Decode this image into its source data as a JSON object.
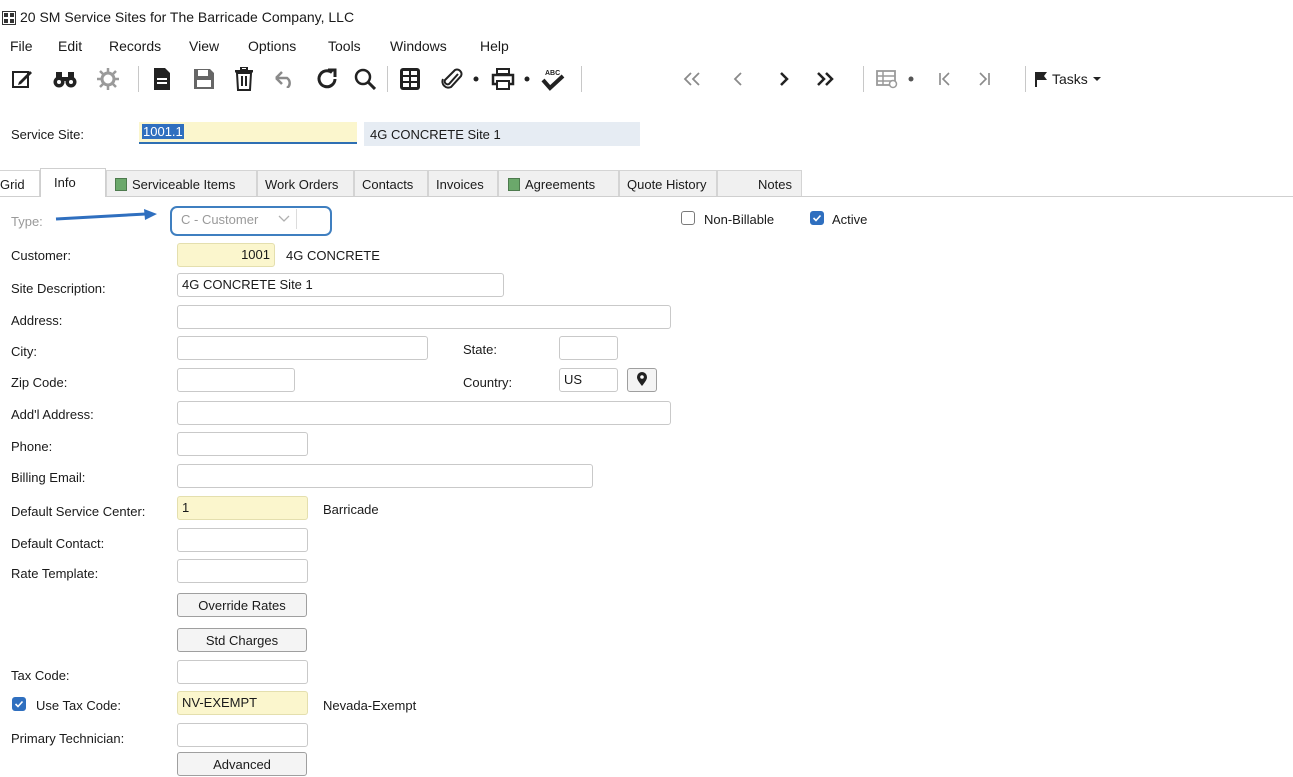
{
  "window": {
    "title": "20 SM Service Sites for The Barricade Company, LLC",
    "icon": "app-window-icon"
  },
  "menu": [
    "File",
    "Edit",
    "Records",
    "View",
    "Options",
    "Tools",
    "Windows",
    "Help"
  ],
  "toolbar": {
    "icons": [
      "edit-icon",
      "binoculars-icon",
      "settings-icon",
      "new-document-icon",
      "save-icon",
      "delete-icon",
      "undo-icon",
      "refresh-icon",
      "search-icon",
      "grid-icon",
      "attachment-icon",
      "print-icon",
      "spellcheck-icon",
      "first-record-icon",
      "previous-record-icon",
      "next-record-icon",
      "last-record-icon",
      "table-view-icon",
      "first-icon",
      "last-icon",
      "flag-icon"
    ],
    "tasks_label": "Tasks"
  },
  "header": {
    "service_site_label": "Service Site:",
    "service_site_value": "1001.1",
    "site_description_display": "4G CONCRETE Site 1"
  },
  "tabs": [
    {
      "label": "Grid"
    },
    {
      "label": "Info",
      "active": true
    },
    {
      "label": "Serviceable Items"
    },
    {
      "label": "Work Orders"
    },
    {
      "label": "Contacts"
    },
    {
      "label": "Invoices"
    },
    {
      "label": "Agreements"
    },
    {
      "label": "Quote History"
    },
    {
      "label": "Notes"
    }
  ],
  "form": {
    "type": {
      "label": "Type:",
      "value": "C - Customer"
    },
    "non_billable": {
      "label": "Non-Billable",
      "checked": false
    },
    "active": {
      "label": "Active",
      "checked": true
    },
    "customer": {
      "label": "Customer:",
      "value": "1001",
      "name": "4G CONCRETE"
    },
    "site_description": {
      "label": "Site Description:",
      "value": "4G CONCRETE Site 1"
    },
    "address": {
      "label": "Address:",
      "value": ""
    },
    "city": {
      "label": "City:",
      "value": ""
    },
    "state": {
      "label": "State:",
      "value": ""
    },
    "zip": {
      "label": "Zip Code:",
      "value": ""
    },
    "country": {
      "label": "Country:",
      "value": "US"
    },
    "addl_address": {
      "label": "Add'l Address:",
      "value": ""
    },
    "phone": {
      "label": "Phone:",
      "value": ""
    },
    "billing_email": {
      "label": "Billing Email:",
      "value": ""
    },
    "default_service_center": {
      "label": "Default Service Center:",
      "value": "1",
      "name": "Barricade"
    },
    "default_contact": {
      "label": "Default Contact:",
      "value": ""
    },
    "rate_template": {
      "label": "Rate Template:",
      "value": ""
    },
    "override_rates_button": "Override Rates",
    "std_charges_button": "Std Charges",
    "tax_code": {
      "label": "Tax Code:",
      "value": ""
    },
    "use_tax_code": {
      "label": "Use Tax Code:",
      "checked": true,
      "value": "NV-EXEMPT",
      "name": "Nevada-Exempt"
    },
    "primary_technician": {
      "label": "Primary Technician:",
      "value": ""
    },
    "advanced_button": "Advanced"
  },
  "colors": {
    "accent": "#2f6fbf",
    "required_field": "#fbf6cd",
    "annotation_arrow": "#2f6fbf"
  }
}
